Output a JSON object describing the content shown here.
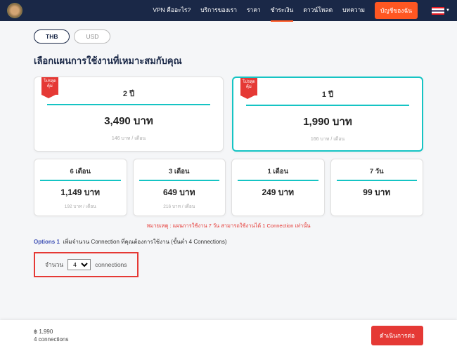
{
  "nav": {
    "items": [
      "VPN คืออะไร?",
      "บริการของเรา",
      "ราคา",
      "ชำระเงิน",
      "ดาวน์โหลด",
      "บทความ"
    ],
    "account": "บัญชีของฉัน"
  },
  "currency": {
    "thb": "THB",
    "usd": "USD"
  },
  "heading": "เลือกแผนการใช้งานที่เหมาะสมกับคุณ",
  "badge": {
    "line1": "โปรสุด",
    "line2": "คุ้ม"
  },
  "plans_top": [
    {
      "title": "2 ปี",
      "price": "3,490 บาท",
      "sub": "146 บาท / เดือน"
    },
    {
      "title": "1 ปี",
      "price": "1,990 บาท",
      "sub": "166 บาท / เดือน"
    }
  ],
  "plans_bottom": [
    {
      "title": "6 เดือน",
      "price": "1,149 บาท",
      "sub": "192 บาท / เดือน"
    },
    {
      "title": "3 เดือน",
      "price": "649 บาท",
      "sub": "216 บาท / เดือน"
    },
    {
      "title": "1 เดือน",
      "price": "249 บาท",
      "sub": ""
    },
    {
      "title": "7 วัน",
      "price": "99 บาท",
      "sub": ""
    }
  ],
  "note": "หมายเหตุ : แผนการใช้งาน 7 วัน สามารถใช้งานได้ 1 Connection เท่านั้น",
  "options": {
    "label": "Options 1",
    "text": "เพิ่มจำนวน Connection ที่คุณต้องการใช้งาน (ขั้นต่ำ 4 Connections)",
    "qty_label": "จำนวน",
    "qty_value": "4",
    "unit": "connections"
  },
  "footer": {
    "price": "฿ 1,990",
    "conn": "4 connections",
    "cta": "ดำเนินการต่อ"
  }
}
